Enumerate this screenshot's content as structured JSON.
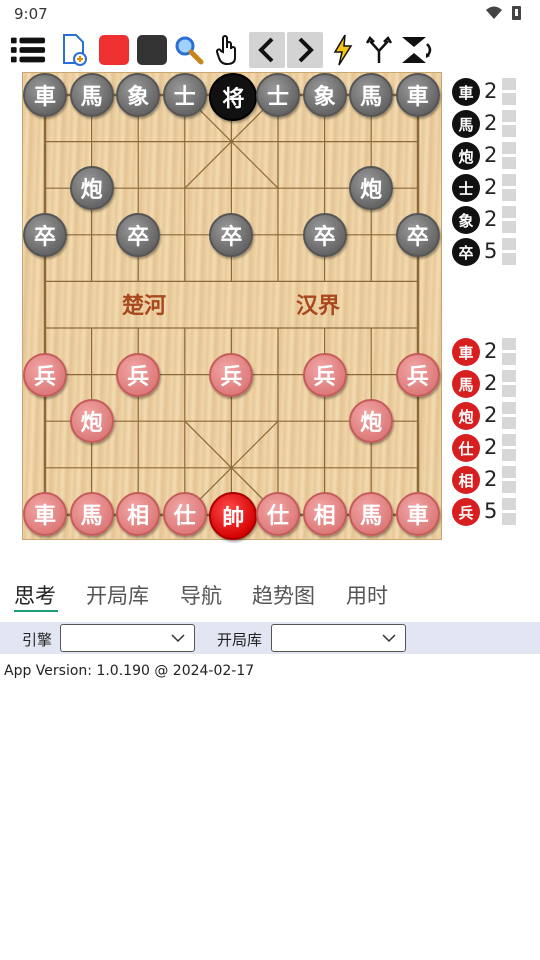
{
  "status_bar": {
    "time": "9:07"
  },
  "toolbar": {
    "items": [
      "menu-icon",
      "new-game-icon",
      "red-square",
      "black-square",
      "magnifier-icon",
      "hand-icon",
      "prev-arrow",
      "next-arrow",
      "lightning-icon",
      "branch-icon",
      "flip-icon"
    ]
  },
  "board": {
    "river_left": "楚河",
    "river_right": "汉界",
    "pieces": [
      {
        "char": "車",
        "side": "black",
        "file": 0,
        "rank": 0
      },
      {
        "char": "馬",
        "side": "black",
        "file": 1,
        "rank": 0
      },
      {
        "char": "象",
        "side": "black",
        "file": 2,
        "rank": 0
      },
      {
        "char": "士",
        "side": "black",
        "file": 3,
        "rank": 0
      },
      {
        "char": "将",
        "side": "black",
        "file": 4,
        "rank": 0,
        "king": true
      },
      {
        "char": "士",
        "side": "black",
        "file": 5,
        "rank": 0
      },
      {
        "char": "象",
        "side": "black",
        "file": 6,
        "rank": 0
      },
      {
        "char": "馬",
        "side": "black",
        "file": 7,
        "rank": 0
      },
      {
        "char": "車",
        "side": "black",
        "file": 8,
        "rank": 0
      },
      {
        "char": "炮",
        "side": "black",
        "file": 1,
        "rank": 2
      },
      {
        "char": "炮",
        "side": "black",
        "file": 7,
        "rank": 2
      },
      {
        "char": "卒",
        "side": "black",
        "file": 0,
        "rank": 3
      },
      {
        "char": "卒",
        "side": "black",
        "file": 2,
        "rank": 3
      },
      {
        "char": "卒",
        "side": "black",
        "file": 4,
        "rank": 3
      },
      {
        "char": "卒",
        "side": "black",
        "file": 6,
        "rank": 3
      },
      {
        "char": "卒",
        "side": "black",
        "file": 8,
        "rank": 3
      },
      {
        "char": "兵",
        "side": "red",
        "file": 0,
        "rank": 6
      },
      {
        "char": "兵",
        "side": "red",
        "file": 2,
        "rank": 6
      },
      {
        "char": "兵",
        "side": "red",
        "file": 4,
        "rank": 6
      },
      {
        "char": "兵",
        "side": "red",
        "file": 6,
        "rank": 6
      },
      {
        "char": "兵",
        "side": "red",
        "file": 8,
        "rank": 6
      },
      {
        "char": "炮",
        "side": "red",
        "file": 1,
        "rank": 7
      },
      {
        "char": "炮",
        "side": "red",
        "file": 7,
        "rank": 7
      },
      {
        "char": "車",
        "side": "red",
        "file": 0,
        "rank": 9
      },
      {
        "char": "馬",
        "side": "red",
        "file": 1,
        "rank": 9
      },
      {
        "char": "相",
        "side": "red",
        "file": 2,
        "rank": 9
      },
      {
        "char": "仕",
        "side": "red",
        "file": 3,
        "rank": 9
      },
      {
        "char": "帥",
        "side": "red",
        "file": 4,
        "rank": 9,
        "king": true
      },
      {
        "char": "仕",
        "side": "red",
        "file": 5,
        "rank": 9
      },
      {
        "char": "相",
        "side": "red",
        "file": 6,
        "rank": 9
      },
      {
        "char": "馬",
        "side": "red",
        "file": 7,
        "rank": 9
      },
      {
        "char": "車",
        "side": "red",
        "file": 8,
        "rank": 9
      }
    ]
  },
  "captured": {
    "black": [
      {
        "char": "車",
        "count": "2"
      },
      {
        "char": "馬",
        "count": "2"
      },
      {
        "char": "炮",
        "count": "2"
      },
      {
        "char": "士",
        "count": "2"
      },
      {
        "char": "象",
        "count": "2"
      },
      {
        "char": "卒",
        "count": "5"
      }
    ],
    "red": [
      {
        "char": "車",
        "count": "2"
      },
      {
        "char": "馬",
        "count": "2"
      },
      {
        "char": "炮",
        "count": "2"
      },
      {
        "char": "仕",
        "count": "2"
      },
      {
        "char": "相",
        "count": "2"
      },
      {
        "char": "兵",
        "count": "5"
      }
    ]
  },
  "tabs": [
    {
      "label": "思考",
      "active": true
    },
    {
      "label": "开局库"
    },
    {
      "label": "导航"
    },
    {
      "label": "趋势图"
    },
    {
      "label": "用时"
    }
  ],
  "settings": {
    "engine_label": "引擎",
    "engine_value": "",
    "book_label": "开局库",
    "book_value": ""
  },
  "version": "App Version: 1.0.190 @ 2024-02-17"
}
